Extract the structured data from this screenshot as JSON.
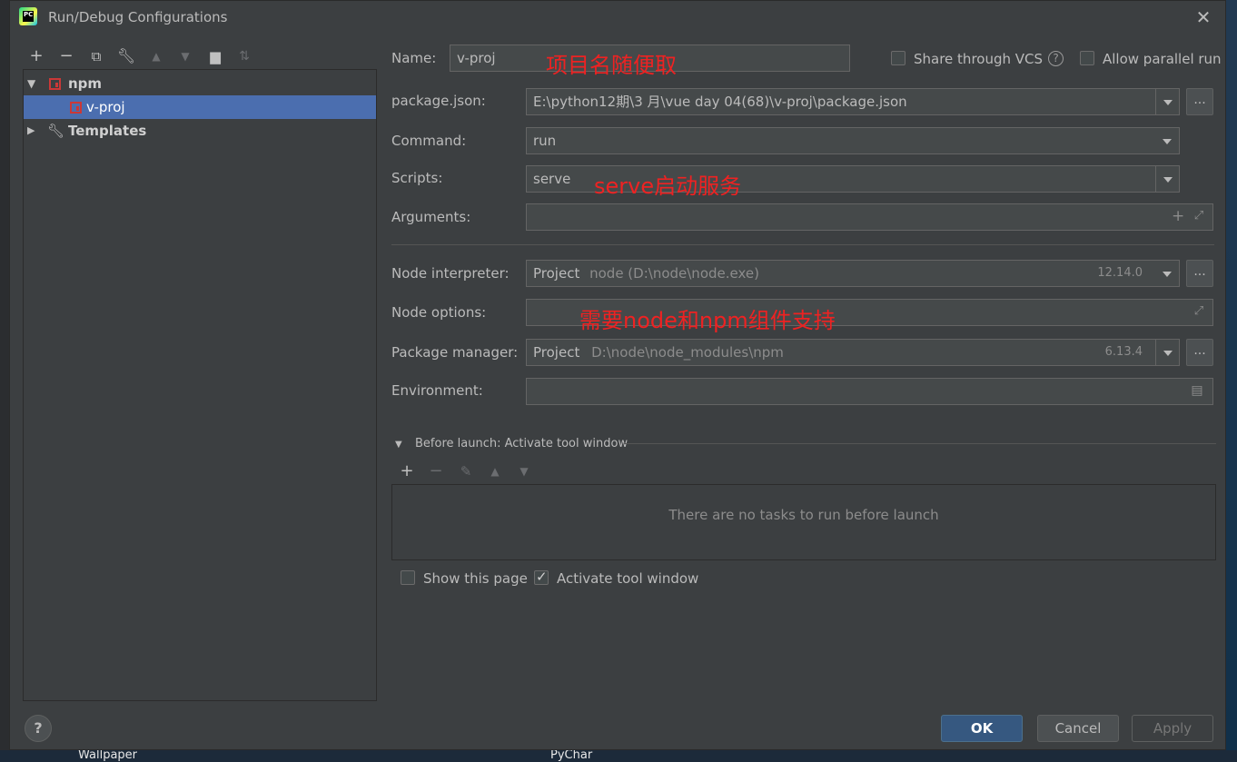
{
  "window": {
    "title": "Run/Debug Configurations"
  },
  "tree": {
    "group": "npm",
    "item": "v-proj",
    "templates": "Templates"
  },
  "form": {
    "name": {
      "label": "Name:",
      "value": "v-proj",
      "annotation": "项目名随便取"
    },
    "share_vcs": {
      "label": "Share through VCS",
      "checked": false
    },
    "allow_parallel": {
      "label": "Allow parallel run",
      "checked": false
    },
    "package_json": {
      "label": "package.json:",
      "value": "E:\\python12期\\3 月\\vue day 04(68)\\v-proj\\package.json"
    },
    "command": {
      "label": "Command:",
      "value": "run"
    },
    "scripts": {
      "label": "Scripts:",
      "value": "serve",
      "annotation": "serve启动服务"
    },
    "arguments": {
      "label": "Arguments:",
      "value": ""
    },
    "node_interpreter": {
      "label": "Node interpreter:",
      "prefix": "Project",
      "value": "node (D:\\node\\node.exe)",
      "version": "12.14.0"
    },
    "node_options": {
      "label": "Node options:",
      "value": "",
      "annotation": "需要node和npm组件支持"
    },
    "package_manager": {
      "label": "Package manager:",
      "prefix": "Project",
      "value": "D:\\node\\node_modules\\npm",
      "version": "6.13.4"
    },
    "environment": {
      "label": "Environment:",
      "value": ""
    }
  },
  "before_launch": {
    "title": "Before launch: Activate tool window",
    "empty_text": "There are no tasks to run before launch"
  },
  "options": {
    "show_page": {
      "label": "Show this page",
      "checked": false
    },
    "activate_tool": {
      "label": "Activate tool window",
      "checked": true
    }
  },
  "buttons": {
    "ok": "OK",
    "cancel": "Cancel",
    "apply": "Apply",
    "help": "?"
  },
  "desktop": {
    "wallpaper": "Wallpaper",
    "pycharm": "PyChar"
  }
}
